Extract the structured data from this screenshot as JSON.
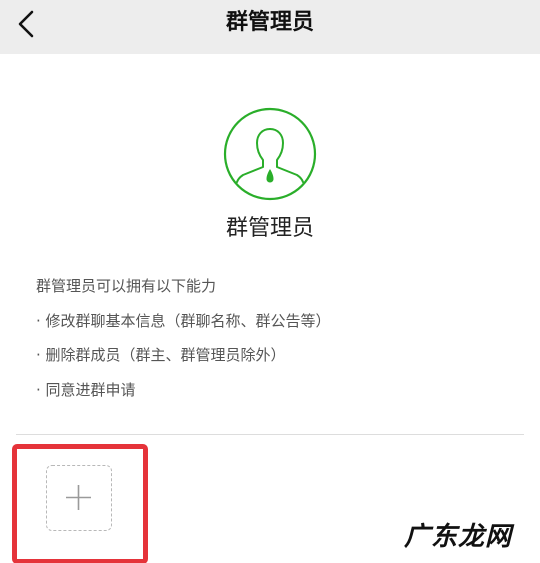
{
  "navbar": {
    "title": "群管理员",
    "back_icon": "chevron-left-icon",
    "background": "#ededed"
  },
  "avatar": {
    "icon": "admin-person-icon",
    "color": "#2aae2a"
  },
  "role_title": "群管理员",
  "description": {
    "intro": "群管理员可以拥有以下能力",
    "items": [
      "· 修改群聊基本信息（群聊名称、群公告等）",
      "· 删除群成员（群主、群管理员除外）",
      "· 同意进群申请"
    ]
  },
  "add_admin": {
    "icon": "plus-icon",
    "highlight_color": "#e5333a"
  },
  "watermark": "广东龙网"
}
